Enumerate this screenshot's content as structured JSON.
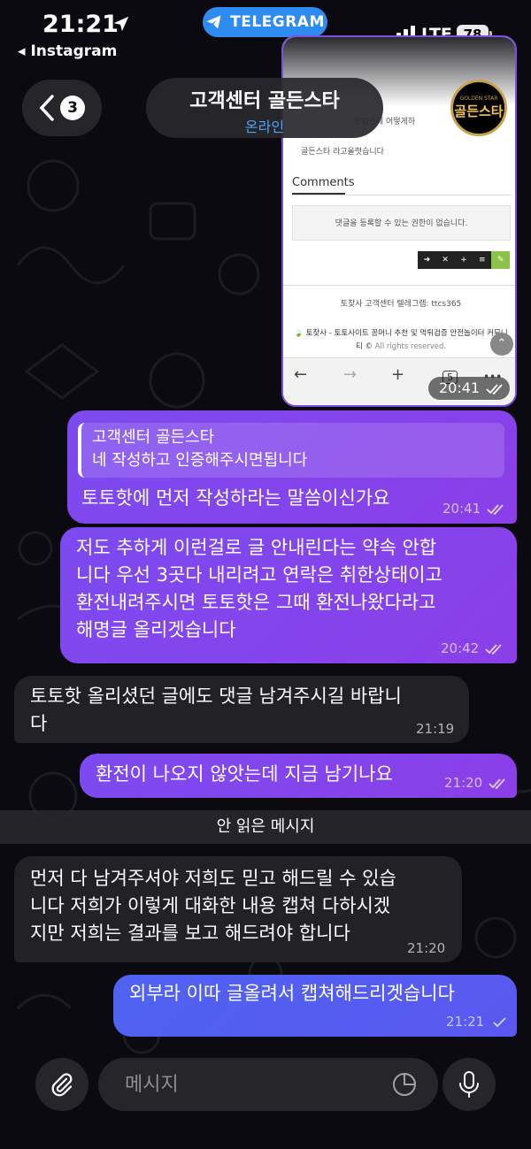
{
  "status_bar": {
    "time": "21:21",
    "back_app": "◂ Instagram",
    "pill_label": "TELEGRAM",
    "network": "LTE",
    "battery": "78"
  },
  "header": {
    "back_count": "3",
    "title": "고객센터 골든스타",
    "status": "온라인",
    "avatar_text": "골든스타",
    "avatar_sub": "GOLDEN STAR"
  },
  "image_message": {
    "fragment_text": "방법인데 어떻게하",
    "line_text": "골든스타 라고올렷습니다",
    "comments_title": "Comments",
    "no_permission": "댓글을 등록할 수 있는 권한이 없습니다.",
    "toolbar": [
      "➜",
      "✕",
      "+",
      "≡",
      "✎"
    ],
    "footer_telegram": "토찾사 고객센터 텔레그램: ttcs365",
    "footer_site": "🍃 토찾사 - 토토사이트 꽁머니 추천 및 먹튀검증 안전놀이터 커뮤니",
    "footer_copyright_a": "티 © ",
    "footer_copyright_b": "All rights reserved.",
    "nav": [
      "←",
      "→",
      "+",
      "5",
      "•••"
    ],
    "time": "20:41"
  },
  "messages": [
    {
      "direction": "out",
      "reply_to": {
        "name": "고객센터 골든스타",
        "text": "네 작성하고 인증해주시면됩니다"
      },
      "text": "토토핫에 먼저 작성하라는 말씀이신가요",
      "time": "20:41"
    },
    {
      "direction": "out",
      "lines": [
        "저도 추하게 이런걸로 글 안내린다는 약속 안합",
        "니다 우선 3곳다 내리려고 연락은 취한상태이고",
        "환전내려주시면 토토핫은 그때 환전나왔다라고",
        "해명글 올리겟습니다"
      ],
      "time": "20:42"
    },
    {
      "direction": "in",
      "lines": [
        "토토핫 올리셨던 글에도 댓글 남겨주시길 바랍니",
        "다"
      ],
      "time": "21:19"
    },
    {
      "direction": "out",
      "text": "환전이 나오지 않앗는데 지금 남기나요",
      "time": "21:20"
    },
    {
      "direction": "in",
      "lines": [
        "먼저 다 남겨주셔야 저희도 믿고 해드릴 수 있습",
        "니다 저희가 이렇게 대화한 내용 캡쳐 다하시겠",
        "지만 저희는 결과를 보고 해드려야 합니다"
      ],
      "time": "21:20"
    },
    {
      "direction": "out",
      "text": "외부라 이따 글올려서 캡쳐해드리겟습니다",
      "time": "21:21"
    }
  ],
  "unread_divider": "안 읽은 메시지",
  "composer": {
    "placeholder": "메시지"
  },
  "colors": {
    "outgoing": "#7c4bf0",
    "outgoing_last": "#5b5cf0",
    "incoming": "#222126",
    "accent": "#2e8cf0"
  }
}
